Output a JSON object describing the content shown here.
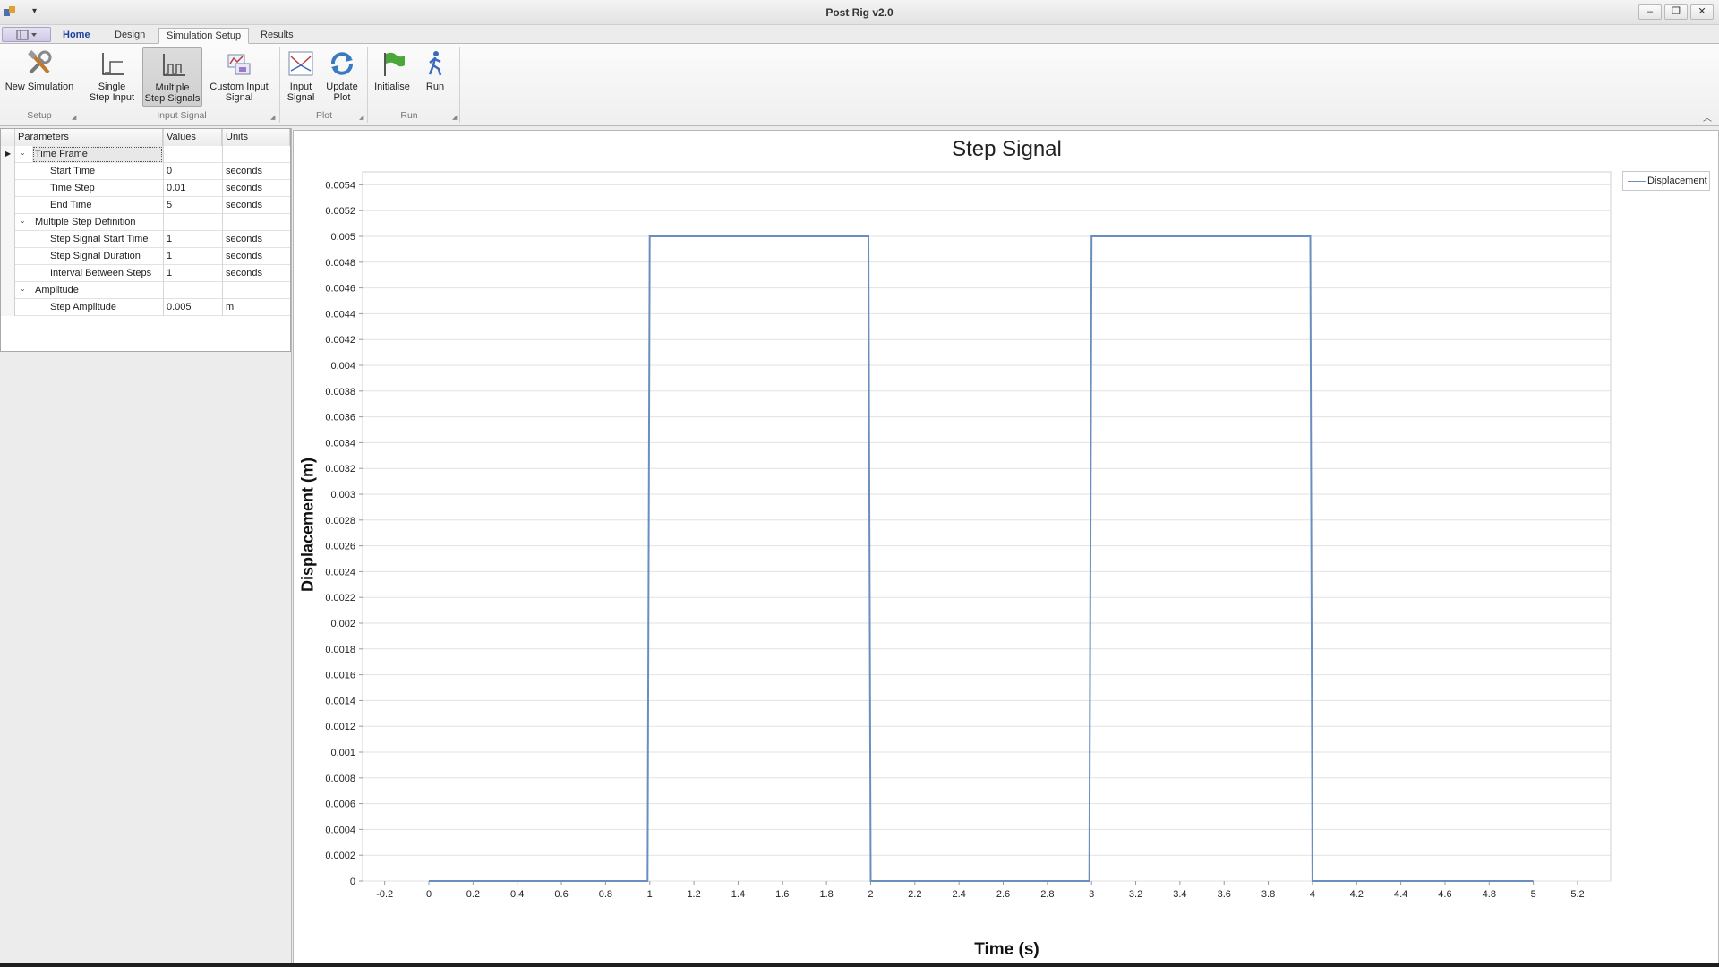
{
  "window": {
    "title": "Post Rig v2.0",
    "qat_dropdown": "▾",
    "minimize": "–",
    "restore": "❐",
    "close": "✕"
  },
  "tabs": [
    {
      "label": "Home"
    },
    {
      "label": "Design"
    },
    {
      "label": "Simulation Setup"
    },
    {
      "label": "Results"
    }
  ],
  "ribbon": {
    "groups": [
      "Setup",
      "Input Signal",
      "Plot",
      "Run"
    ],
    "buttons": {
      "new_simulation": "New Simulation",
      "single_step_1": "Single",
      "single_step_2": "Step Input",
      "multiple_step_1": "Multiple",
      "multiple_step_2": "Step Signals",
      "custom_input_1": "Custom Input",
      "custom_input_2": "Signal",
      "input_signal_1": "Input",
      "input_signal_2": "Signal",
      "update_plot_1": "Update",
      "update_plot_2": "Plot",
      "initialise": "Initialise",
      "run": "Run"
    }
  },
  "grid": {
    "headers": {
      "parameters": "Parameters",
      "values": "Values",
      "units": "Units"
    },
    "categories": {
      "time_frame": "Time Frame",
      "multi_step": "Multiple Step Definition",
      "amplitude": "Amplitude"
    },
    "rows": [
      {
        "name": "Start Time",
        "value": "0",
        "unit": "seconds"
      },
      {
        "name": "Time Step",
        "value": "0.01",
        "unit": "seconds"
      },
      {
        "name": "End Time",
        "value": "5",
        "unit": "seconds"
      },
      {
        "name": "Step Signal Start Time",
        "value": "1",
        "unit": "seconds"
      },
      {
        "name": "Step Signal Duration",
        "value": "1",
        "unit": "seconds"
      },
      {
        "name": "Interval Between Steps",
        "value": "1",
        "unit": "seconds"
      },
      {
        "name": "Step Amplitude",
        "value": "0.005",
        "unit": "m"
      }
    ]
  },
  "chart_data": {
    "type": "line",
    "title": "Step Signal",
    "xlabel": "Time (s)",
    "ylabel": "Displacement (m)",
    "xlim": [
      -0.3,
      5.35
    ],
    "ylim": [
      0,
      0.0055
    ],
    "x_ticks": [
      "-0.2",
      "0",
      "0.2",
      "0.4",
      "0.6",
      "0.8",
      "1",
      "1.2",
      "1.4",
      "1.6",
      "1.8",
      "2",
      "2.2",
      "2.4",
      "2.6",
      "2.8",
      "3",
      "3.2",
      "3.4",
      "3.6",
      "3.8",
      "4",
      "4.2",
      "4.4",
      "4.6",
      "4.8",
      "5",
      "5.2"
    ],
    "y_ticks": [
      "0",
      "0.0002",
      "0.0004",
      "0.0006",
      "0.0008",
      "0.001",
      "0.0012",
      "0.0014",
      "0.0016",
      "0.0018",
      "0.002",
      "0.0022",
      "0.0024",
      "0.0026",
      "0.0028",
      "0.003",
      "0.0032",
      "0.0034",
      "0.0036",
      "0.0038",
      "0.004",
      "0.0042",
      "0.0044",
      "0.0046",
      "0.0048",
      "0.005",
      "0.0052",
      "0.0054"
    ],
    "grid": true,
    "legend_position": "top-right",
    "series": [
      {
        "name": "Displacement",
        "color": "#6a8fbf",
        "x": [
          0,
          0.99,
          1,
          1.99,
          2,
          2.99,
          3,
          3.99,
          4,
          5
        ],
        "y": [
          0,
          0,
          0.005,
          0.005,
          0,
          0,
          0.005,
          0.005,
          0,
          0
        ]
      }
    ]
  }
}
